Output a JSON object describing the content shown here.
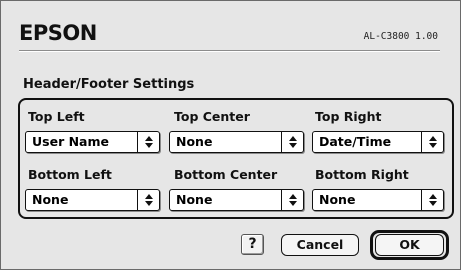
{
  "header": {
    "brand": "EPSON",
    "model": "AL-C3800 1.00"
  },
  "section": {
    "title": "Header/Footer Settings"
  },
  "fields": {
    "top_left": {
      "label": "Top Left",
      "value": "User Name"
    },
    "top_center": {
      "label": "Top Center",
      "value": "None"
    },
    "top_right": {
      "label": "Top Right",
      "value": "Date/Time"
    },
    "bottom_left": {
      "label": "Bottom Left",
      "value": "None"
    },
    "bottom_center": {
      "label": "Bottom Center",
      "value": "None"
    },
    "bottom_right": {
      "label": "Bottom Right",
      "value": "None"
    }
  },
  "buttons": {
    "help": "?",
    "cancel": "Cancel",
    "ok": "OK"
  },
  "icons": {
    "popup_arrows": "updown-arrows-icon",
    "help": "question-mark-icon"
  }
}
